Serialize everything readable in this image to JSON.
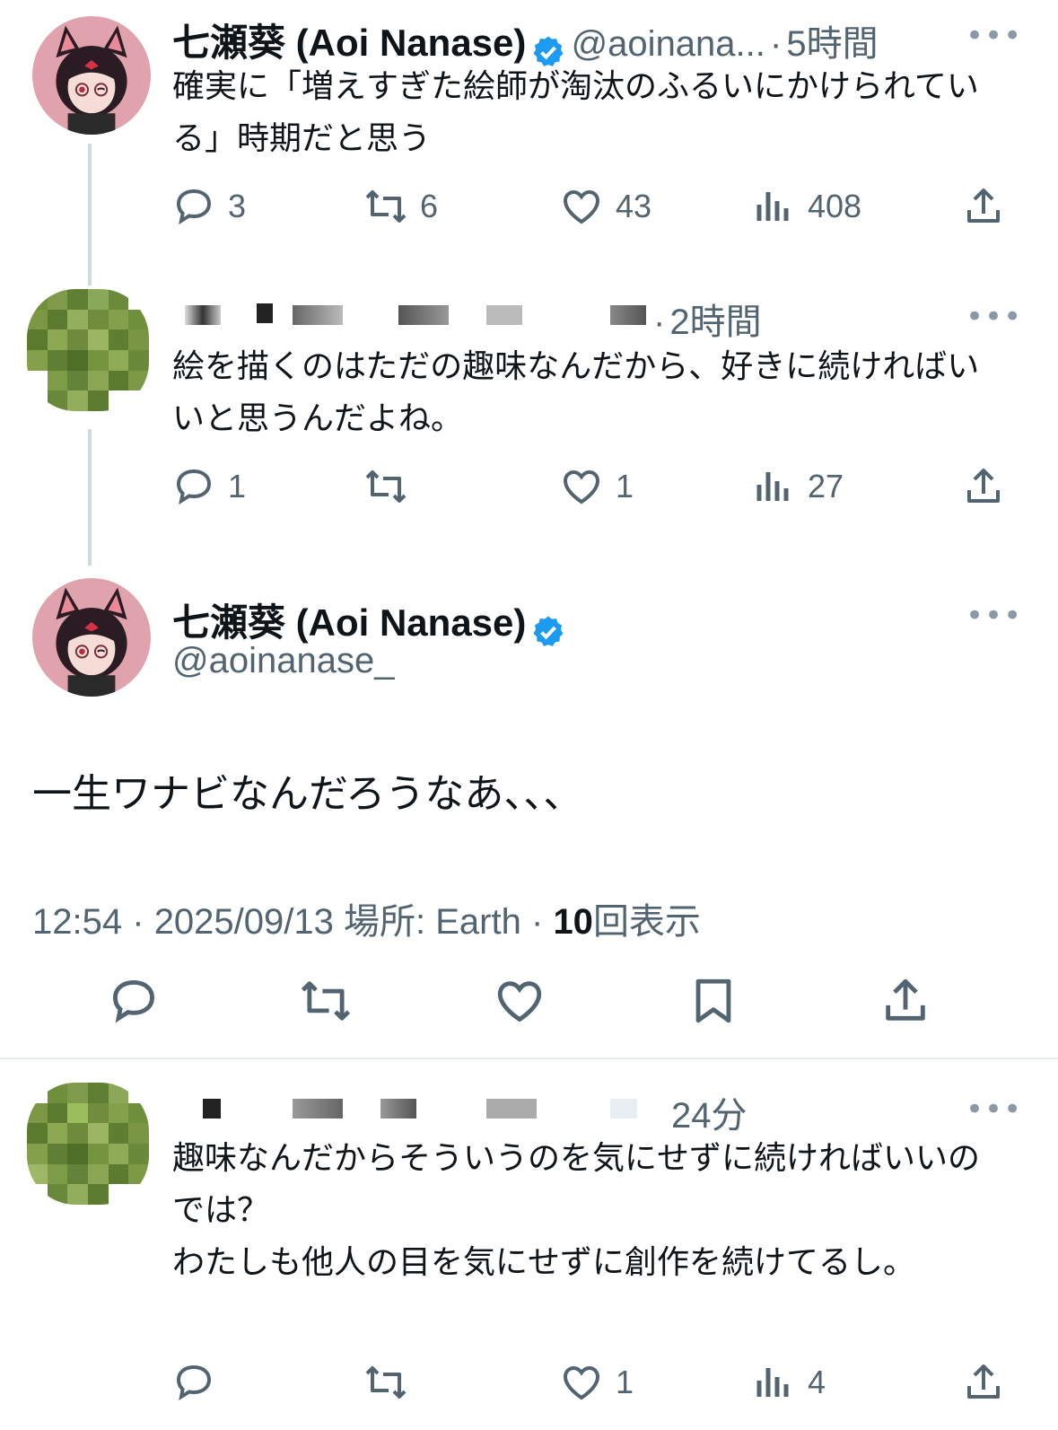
{
  "tweet1": {
    "name": "七瀬葵 (Aoi Nanase)",
    "handle": "@aoinana...",
    "dot": "·",
    "time": "5時間",
    "more": "•••",
    "text": "確実に「増えすぎた絵師が淘汰のふるいにかけられている」時期だと思う",
    "replies": "3",
    "retweets": "6",
    "likes": "43",
    "views": "408"
  },
  "reply1": {
    "dot": "·",
    "time": "2時間",
    "more": "•••",
    "text": "絵を描くのはただの趣味なんだから、好きに続ければいいと思うんだよね。",
    "replies": "1",
    "retweets": "",
    "likes": "1",
    "views": "27"
  },
  "main": {
    "name": "七瀬葵 (Aoi Nanase)",
    "handle": "@aoinanase_",
    "more": "•••",
    "text": "一生ワナビなんだろうなあ、、、",
    "time": "12:54",
    "date": "2025/09/13",
    "place_label": "場所: Earth",
    "views_count": "10",
    "views_label": "回表示",
    "sep": "·"
  },
  "reply2": {
    "time": "24分",
    "more": "•••",
    "text": "趣味なんだからそういうのを気にせずに続ければいいのでは？\nわたしも他人の目を気にせずに創作を続けてるし。",
    "replies": "",
    "retweets": "",
    "likes": "1",
    "views": "4"
  },
  "colors": {
    "verified": "#1d9bf0",
    "text": "#0f1419",
    "muted": "#536471",
    "line": "#cfd9de"
  },
  "icons": [
    "reply-icon",
    "retweet-icon",
    "like-icon",
    "views-icon",
    "share-icon",
    "bookmark-icon",
    "verified-icon",
    "more-icon"
  ]
}
